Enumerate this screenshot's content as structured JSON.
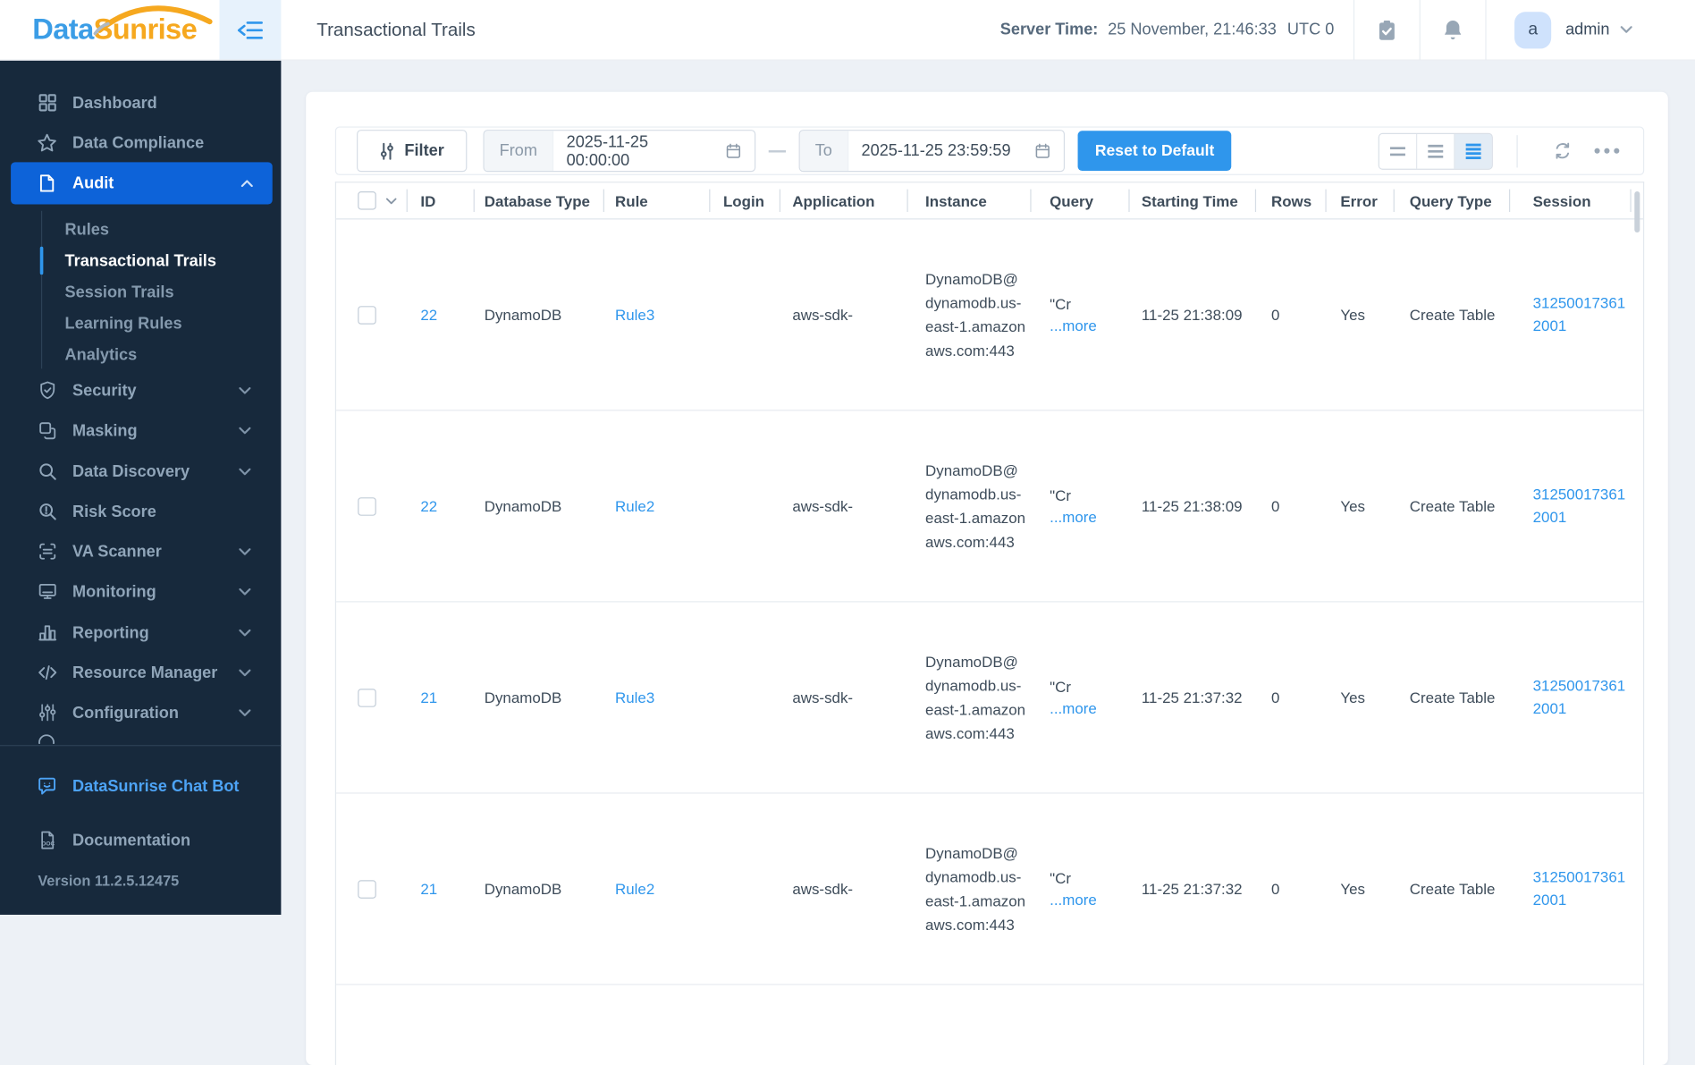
{
  "logo": {
    "part1": "Data",
    "part2": "Sunrise"
  },
  "topbar": {
    "title": "Transactional Trails",
    "server_time_label": "Server Time:",
    "server_time_value": "25 November, 21:46:33",
    "server_time_zone": "UTC 0",
    "user_initial": "a",
    "user_name": "admin"
  },
  "sidebar": {
    "items": [
      {
        "label": "Dashboard"
      },
      {
        "label": "Data Compliance"
      },
      {
        "label": "Audit"
      },
      {
        "label": "Security"
      },
      {
        "label": "Masking"
      },
      {
        "label": "Data Discovery"
      },
      {
        "label": "Risk Score"
      },
      {
        "label": "VA Scanner"
      },
      {
        "label": "Monitoring"
      },
      {
        "label": "Reporting"
      },
      {
        "label": "Resource Manager"
      },
      {
        "label": "Configuration"
      }
    ],
    "audit_submenu": [
      {
        "label": "Rules"
      },
      {
        "label": "Transactional Trails"
      },
      {
        "label": "Session Trails"
      },
      {
        "label": "Learning Rules"
      },
      {
        "label": "Analytics"
      }
    ],
    "chat_bot_label": "DataSunrise Chat Bot",
    "documentation_label": "Documentation",
    "version": "Version 11.2.5.12475"
  },
  "toolbar": {
    "filter_label": "Filter",
    "from_label": "From",
    "from_value": "2025-11-25 00:00:00",
    "to_label": "To",
    "to_value": "2025-11-25 23:59:59",
    "reset_label": "Reset to Default"
  },
  "table": {
    "columns": [
      "ID",
      "Database Type",
      "Rule",
      "Login",
      "Application",
      "Instance",
      "Query",
      "Starting Time",
      "Rows",
      "Error",
      "Query Type",
      "Session"
    ],
    "rows": [
      {
        "id": "22",
        "database_type": "DynamoDB",
        "rule": "Rule3",
        "login": "",
        "application": "aws-sdk-",
        "instance": "DynamoDB@dynamodb.us-east-1.amazonaws.com:443",
        "query": "\"Cr",
        "more": "...more",
        "starting_time": "11-25 21:38:09",
        "rows": "0",
        "error": "Yes",
        "query_type": "Create Table",
        "session": "312500173612001"
      },
      {
        "id": "22",
        "database_type": "DynamoDB",
        "rule": "Rule2",
        "login": "",
        "application": "aws-sdk-",
        "instance": "DynamoDB@dynamodb.us-east-1.amazonaws.com:443",
        "query": "\"Cr",
        "more": "...more",
        "starting_time": "11-25 21:38:09",
        "rows": "0",
        "error": "Yes",
        "query_type": "Create Table",
        "session": "312500173612001"
      },
      {
        "id": "21",
        "database_type": "DynamoDB",
        "rule": "Rule3",
        "login": "",
        "application": "aws-sdk-",
        "instance": "DynamoDB@dynamodb.us-east-1.amazonaws.com:443",
        "query": "\"Cr",
        "more": "...more",
        "starting_time": "11-25 21:37:32",
        "rows": "0",
        "error": "Yes",
        "query_type": "Create Table",
        "session": "312500173612001"
      },
      {
        "id": "21",
        "database_type": "DynamoDB",
        "rule": "Rule2",
        "login": "",
        "application": "aws-sdk-",
        "instance": "DynamoDB@dynamodb.us-east-1.amazonaws.com:443",
        "query": "\"Cr",
        "more": "...more",
        "starting_time": "11-25 21:37:32",
        "rows": "0",
        "error": "Yes",
        "query_type": "Create Table",
        "session": "312500173612001"
      }
    ]
  },
  "colors": {
    "accent_blue": "#2f96ec",
    "active_nav_blue": "#0d63d9",
    "sidebar_bg": "#17293c",
    "page_bg": "#edf1f6",
    "logo_blue": "#3b9de6",
    "logo_orange": "#f6a81f"
  }
}
